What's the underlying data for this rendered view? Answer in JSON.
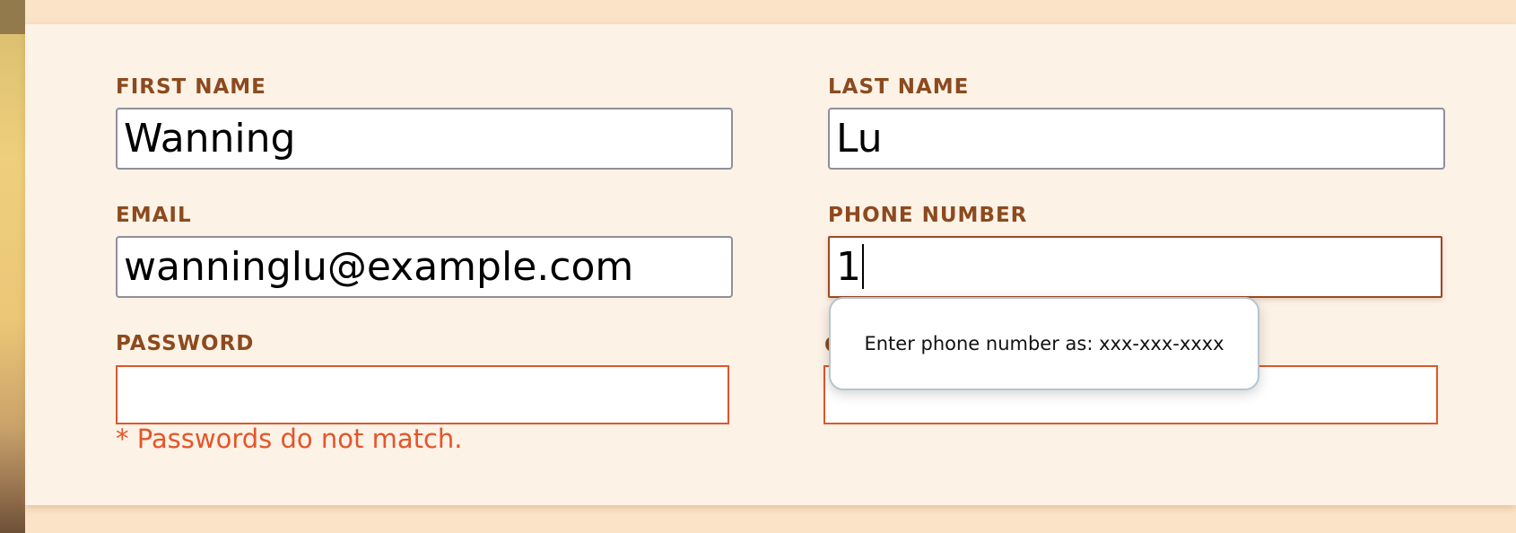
{
  "form": {
    "first_name": {
      "label": "FIRST NAME",
      "value": "Wanning"
    },
    "last_name": {
      "label": "LAST NAME",
      "value": "Lu"
    },
    "email": {
      "label": "EMAIL",
      "value": "wanninglu@example.com"
    },
    "phone": {
      "label": "PHONE NUMBER",
      "value": "1"
    },
    "password": {
      "label": "PASSWORD",
      "value": ""
    },
    "confirm_password": {
      "label_peek": "C",
      "value": ""
    },
    "password_error": "* Passwords do not match.",
    "phone_tooltip": "Enter phone number as: xxx-xxx-xxxx"
  },
  "colors": {
    "label": "#8c4a1e",
    "error": "#e4552a",
    "card_background": "#fcf2e6",
    "page_background": "#fbe3c8"
  }
}
